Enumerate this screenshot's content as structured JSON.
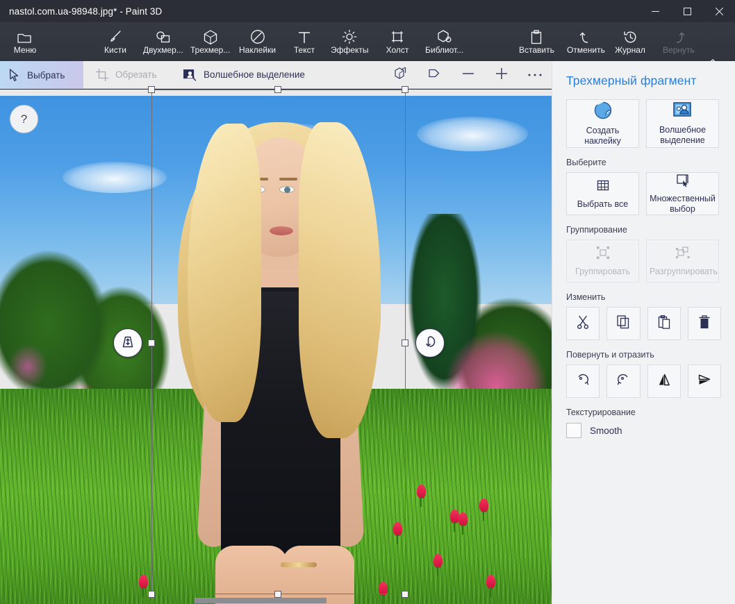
{
  "window": {
    "title": "nastol.com.ua-98948.jpg* - Paint 3D",
    "minimize_label": "minimize",
    "maximize_label": "maximize",
    "close_label": "close"
  },
  "ribbon": {
    "items": [
      {
        "label": "Меню",
        "icon": "folder-icon",
        "disabled": false
      },
      {
        "label": "Кисти",
        "icon": "brush-icon",
        "disabled": false
      },
      {
        "label": "Двухмер...",
        "icon": "shapes-2d-icon",
        "disabled": false
      },
      {
        "label": "Трехмер...",
        "icon": "cube-3d-icon",
        "disabled": false
      },
      {
        "label": "Наклейки",
        "icon": "sticker-icon",
        "disabled": false
      },
      {
        "label": "Текст",
        "icon": "text-icon",
        "disabled": false
      },
      {
        "label": "Эффекты",
        "icon": "effects-icon",
        "disabled": false
      },
      {
        "label": "Холст",
        "icon": "canvas-icon",
        "disabled": false
      },
      {
        "label": "Библиот...",
        "icon": "library-3d-icon",
        "disabled": false
      }
    ],
    "right_items": [
      {
        "label": "Вставить",
        "icon": "paste-icon",
        "disabled": false
      },
      {
        "label": "Отменить",
        "icon": "undo-icon",
        "disabled": false
      },
      {
        "label": "Журнал",
        "icon": "history-icon",
        "disabled": false
      },
      {
        "label": "Вернуть",
        "icon": "redo-icon",
        "disabled": true
      }
    ],
    "collapse_icon": "chevron-up-icon"
  },
  "subbar": {
    "select_label": "Выбрать",
    "crop_label": "Обрезать",
    "magic_select_label": "Волшебное выделение",
    "view_3d_icon": "view-3d-icon",
    "perspective_icon": "perspective-icon",
    "zoom_out_icon": "minus-icon",
    "zoom_in_icon": "plus-icon",
    "more_icon": "ellipsis-icon"
  },
  "canvas": {
    "help_label": "?",
    "depth_handle_icon": "depth-move-icon",
    "rotate_handle_icon": "rotate-z-icon",
    "scrollbar": "horizontal-scrollbar"
  },
  "panel": {
    "title": "Трехмерный фрагмент",
    "top_actions": [
      {
        "label": "Создать наклейку",
        "icon": "make-sticker-icon"
      },
      {
        "label": "Волшебное выделение",
        "icon": "magic-select-icon"
      }
    ],
    "select_group": {
      "label": "Выберите",
      "buttons": [
        {
          "label": "Выбрать все",
          "icon": "select-all-icon"
        },
        {
          "label": "Множественный выбор",
          "icon": "multi-select-icon"
        }
      ]
    },
    "group_group": {
      "label": "Группирование",
      "buttons": [
        {
          "label": "Группировать",
          "icon": "group-icon",
          "disabled": true
        },
        {
          "label": "Разгруппировать",
          "icon": "ungroup-icon",
          "disabled": true
        }
      ]
    },
    "edit_group": {
      "label": "Изменить",
      "buttons": [
        {
          "name": "cut",
          "icon": "scissors-icon"
        },
        {
          "name": "copy",
          "icon": "copy-icon"
        },
        {
          "name": "paste",
          "icon": "paste-icon"
        },
        {
          "name": "delete",
          "icon": "trash-icon"
        }
      ]
    },
    "rotate_group": {
      "label": "Повернуть и отразить",
      "buttons": [
        {
          "name": "rotate-left",
          "icon": "rotate-ccw-icon"
        },
        {
          "name": "rotate-right",
          "icon": "rotate-cw-icon"
        },
        {
          "name": "flip-horizontal",
          "icon": "flip-h-icon"
        },
        {
          "name": "flip-vertical",
          "icon": "flip-v-icon"
        }
      ]
    },
    "texture_group": {
      "label": "Текстурирование",
      "checkbox_label": "Smooth",
      "checked": false
    }
  },
  "colors": {
    "titlebar": "#2b2e36",
    "ribbon": "#333740",
    "panel_bg": "#f1f2f4",
    "panel_title": "#2a7fd4",
    "accent_text": "#2b2f55",
    "tab_gradient_start": "#bcd9f2",
    "tab_gradient_end": "#cbc7ec"
  }
}
